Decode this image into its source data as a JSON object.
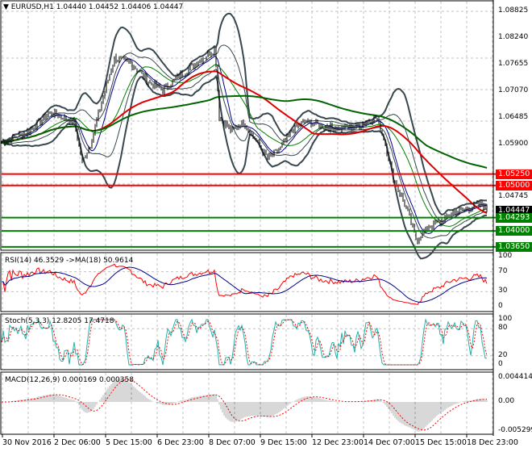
{
  "header": {
    "title": "EURUSD,H1",
    "ohlc": "1.04440 1.04452 1.04406 1.04447"
  },
  "price_axis": [
    "1.08825",
    "1.08240",
    "1.07655",
    "1.07070",
    "1.06485",
    "1.05900",
    "1.04745"
  ],
  "levels": [
    {
      "label": "1.05250",
      "value": 1.0525,
      "color": "#ff0000"
    },
    {
      "label": "1.05000",
      "value": 1.05,
      "color": "#ff0000"
    },
    {
      "label": "1.04447",
      "value": 1.04447,
      "color": "#000000"
    },
    {
      "label": "1.04293",
      "value": 1.04293,
      "color": "#008000"
    },
    {
      "label": "1.04000",
      "value": 1.04,
      "color": "#008000"
    },
    {
      "label": "1.03650",
      "value": 1.0365,
      "color": "#008000"
    }
  ],
  "rsi": {
    "label": "RSI(14) 46.3529  ->MA(18) 50.9614",
    "ticks": [
      "100",
      "70",
      "30",
      "0"
    ]
  },
  "stoch": {
    "label": "Stoch(5,3,3) 12.8205 17.4718",
    "ticks": [
      "100",
      "80",
      "20",
      "0"
    ]
  },
  "macd": {
    "label": "MACD(12,26,9) 0.000169 0.000358",
    "ticks": [
      "0.004414",
      "0.00",
      "-0.005299"
    ]
  },
  "time_axis": [
    "30 Nov 2016",
    "2 Dec 06:00",
    "5 Dec 15:00",
    "6 Dec 23:00",
    "8 Dec 07:00",
    "9 Dec 15:00",
    "12 Dec 23:00",
    "14 Dec 07:00",
    "15 Dec 15:00",
    "18 Dec 23:00"
  ],
  "chart_data": {
    "type": "line",
    "symbol": "EURUSD",
    "timeframe": "H1",
    "ylim": [
      1.0357,
      1.089
    ],
    "close_waypoints": [
      [
        0,
        1.0595
      ],
      [
        30,
        1.0615
      ],
      [
        60,
        1.066
      ],
      [
        90,
        1.064
      ],
      [
        100,
        1.055
      ],
      [
        110,
        1.059
      ],
      [
        130,
        1.072
      ],
      [
        140,
        1.078
      ],
      [
        160,
        1.077
      ],
      [
        180,
        1.073
      ],
      [
        200,
        1.071
      ],
      [
        220,
        1.074
      ],
      [
        250,
        1.078
      ],
      [
        265,
        1.08
      ],
      [
        270,
        1.065
      ],
      [
        285,
        1.062
      ],
      [
        300,
        1.064
      ],
      [
        315,
        1.06
      ],
      [
        330,
        1.056
      ],
      [
        345,
        1.058
      ],
      [
        360,
        1.062
      ],
      [
        375,
        1.064
      ],
      [
        400,
        1.063
      ],
      [
        420,
        1.0625
      ],
      [
        440,
        1.063
      ],
      [
        465,
        1.065
      ],
      [
        475,
        1.06
      ],
      [
        485,
        1.052
      ],
      [
        500,
        1.046
      ],
      [
        515,
        1.038
      ],
      [
        530,
        1.041
      ],
      [
        545,
        1.042
      ],
      [
        560,
        1.044
      ],
      [
        580,
        1.045
      ],
      [
        595,
        1.046
      ],
      [
        602,
        1.0445
      ]
    ]
  }
}
